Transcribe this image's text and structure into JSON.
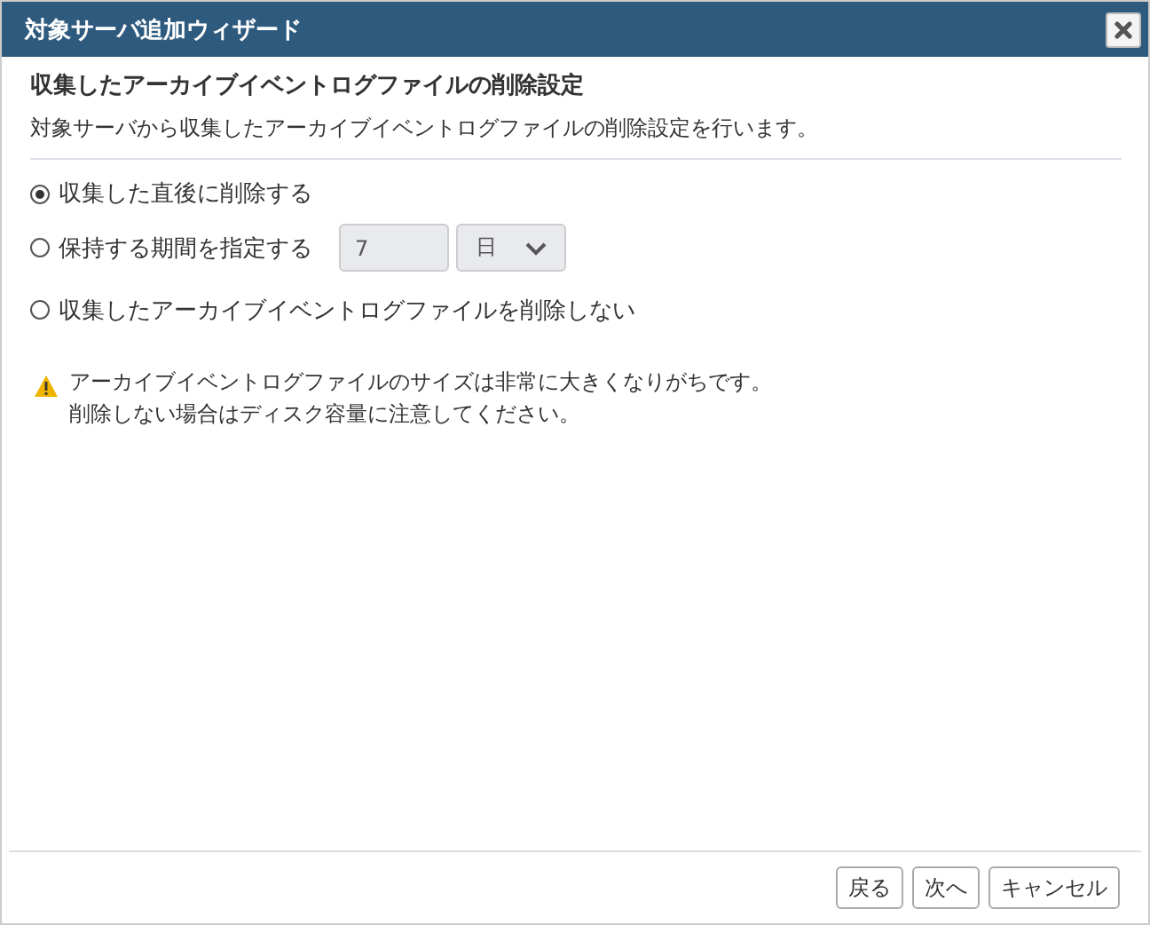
{
  "window": {
    "title": "対象サーバ追加ウィザード"
  },
  "heading": "収集したアーカイブイベントログファイルの削除設定",
  "description": "対象サーバから収集したアーカイブイベントログファイルの削除設定を行います。",
  "options": [
    {
      "label": "収集した直後に削除する",
      "selected": true,
      "kind": "plain"
    },
    {
      "label": "保持する期間を指定する",
      "selected": false,
      "kind": "period",
      "period": {
        "value": "7",
        "disabled": true
      },
      "unit": {
        "value": "日",
        "disabled": true
      }
    },
    {
      "label": "収集したアーカイブイベントログファイルを削除しない",
      "selected": false,
      "kind": "plain"
    }
  ],
  "warning": [
    "アーカイブイベントログファイルのサイズは非常に大きくなりがちです。",
    "削除しない場合はディスク容量に注意してください。"
  ],
  "buttons": [
    "戻る",
    "次へ",
    "キャンセル"
  ]
}
